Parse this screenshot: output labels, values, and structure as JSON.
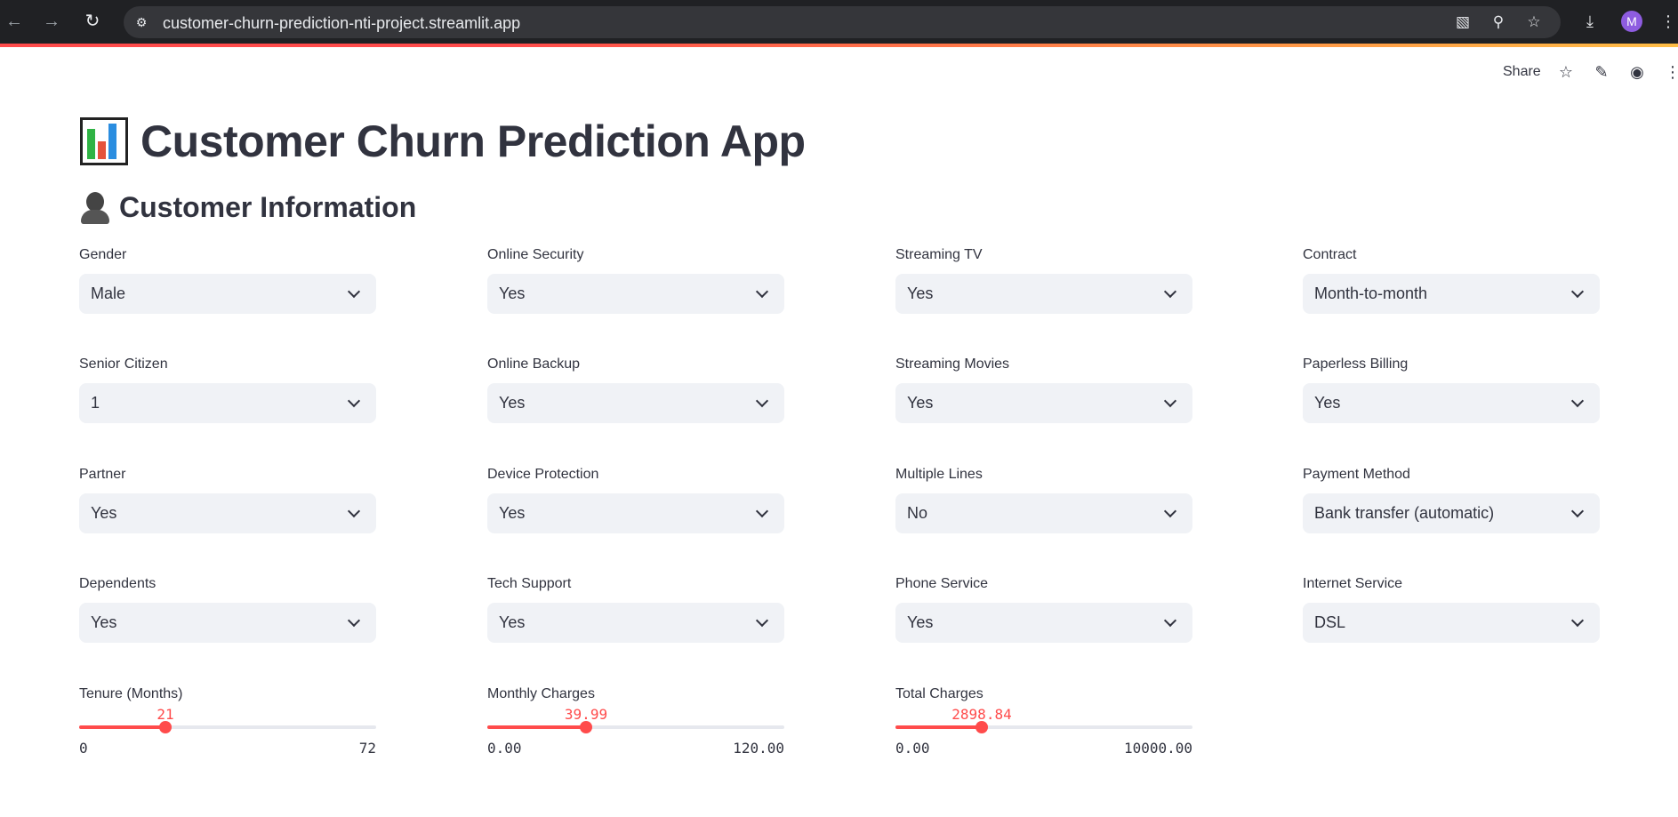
{
  "browser": {
    "url": "customer-churn-prediction-nti-project.streamlit.app",
    "profile_initial": "M"
  },
  "toolbar": {
    "share_label": "Share"
  },
  "page": {
    "title": "Customer Churn Prediction App",
    "section": "Customer Information"
  },
  "fields": {
    "gender": {
      "label": "Gender",
      "value": "Male"
    },
    "senior_citizen": {
      "label": "Senior Citizen",
      "value": "1"
    },
    "partner": {
      "label": "Partner",
      "value": "Yes"
    },
    "dependents": {
      "label": "Dependents",
      "value": "Yes"
    },
    "online_security": {
      "label": "Online Security",
      "value": "Yes"
    },
    "online_backup": {
      "label": "Online Backup",
      "value": "Yes"
    },
    "device_protection": {
      "label": "Device Protection",
      "value": "Yes"
    },
    "tech_support": {
      "label": "Tech Support",
      "value": "Yes"
    },
    "streaming_tv": {
      "label": "Streaming TV",
      "value": "Yes"
    },
    "streaming_movies": {
      "label": "Streaming Movies",
      "value": "Yes"
    },
    "multiple_lines": {
      "label": "Multiple Lines",
      "value": "No"
    },
    "phone_service": {
      "label": "Phone Service",
      "value": "Yes"
    },
    "contract": {
      "label": "Contract",
      "value": "Month-to-month"
    },
    "paperless_billing": {
      "label": "Paperless Billing",
      "value": "Yes"
    },
    "payment_method": {
      "label": "Payment Method",
      "value": "Bank transfer (automatic)"
    },
    "internet_service": {
      "label": "Internet Service",
      "value": "DSL"
    }
  },
  "sliders": {
    "tenure": {
      "label": "Tenure (Months)",
      "value": "21",
      "min": "0",
      "max": "72",
      "num_value": 21,
      "num_min": 0,
      "num_max": 72
    },
    "monthly": {
      "label": "Monthly Charges",
      "value": "39.99",
      "min": "0.00",
      "max": "120.00",
      "num_value": 39.99,
      "num_min": 0,
      "num_max": 120
    },
    "total": {
      "label": "Total Charges",
      "value": "2898.84",
      "min": "0.00",
      "max": "10000.00",
      "num_value": 2898.84,
      "num_min": 0,
      "num_max": 10000
    }
  },
  "colors": {
    "accent": "#ff4b4b",
    "select_bg": "#f0f2f6",
    "text": "#31333f"
  }
}
